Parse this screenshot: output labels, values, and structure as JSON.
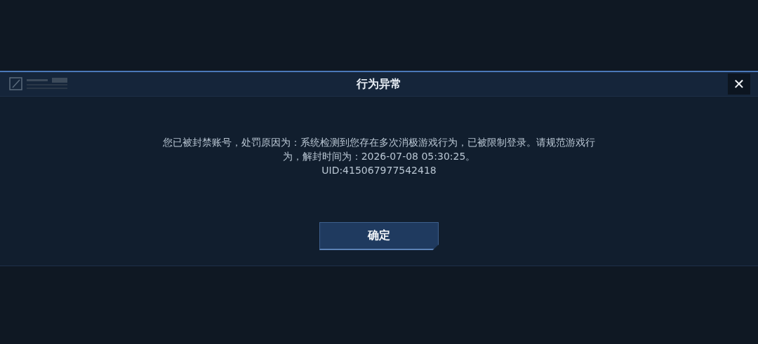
{
  "dialog": {
    "title": "行为异常",
    "message": "您已被封禁账号，处罚原因为：系统检测到您存在多次消极游戏行为，已被限制登录。请规范游戏行为，解封时间为：2026-07-08 05:30:25。",
    "uid": "UID:415067977542418",
    "close_label": "✕",
    "confirm_label": "确定"
  }
}
